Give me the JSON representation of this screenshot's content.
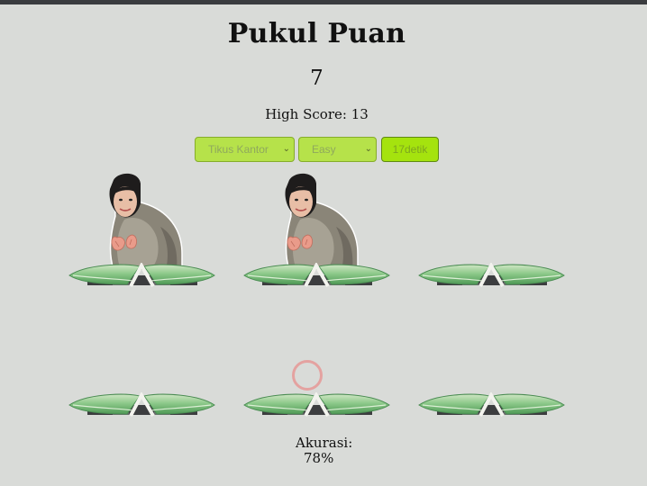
{
  "game": {
    "title": "Pukul Puan",
    "score": "7",
    "high_score_label": "High Score:",
    "high_score_value": "13",
    "accuracy_label": "Akurasi:",
    "accuracy_value": "78%"
  },
  "controls": {
    "character_select": {
      "selected": "Tikus Kantor"
    },
    "difficulty_select": {
      "selected": "Easy"
    },
    "timer_button": {
      "label": "17detik"
    }
  },
  "board": {
    "holes": [
      {
        "row": 1,
        "col": 1,
        "has_mole": true
      },
      {
        "row": 1,
        "col": 2,
        "has_mole": true
      },
      {
        "row": 1,
        "col": 3,
        "has_mole": false
      },
      {
        "row": 2,
        "col": 1,
        "has_mole": false
      },
      {
        "row": 2,
        "col": 2,
        "has_mole": false
      },
      {
        "row": 2,
        "col": 3,
        "has_mole": false
      }
    ]
  },
  "colors": {
    "background": "#d9dbd8",
    "select_fill": "#b6e24a",
    "timer_fill": "#a5e30e",
    "leaf_green": "#7fbf7a",
    "cursor_ring": "#e4a2a0"
  }
}
